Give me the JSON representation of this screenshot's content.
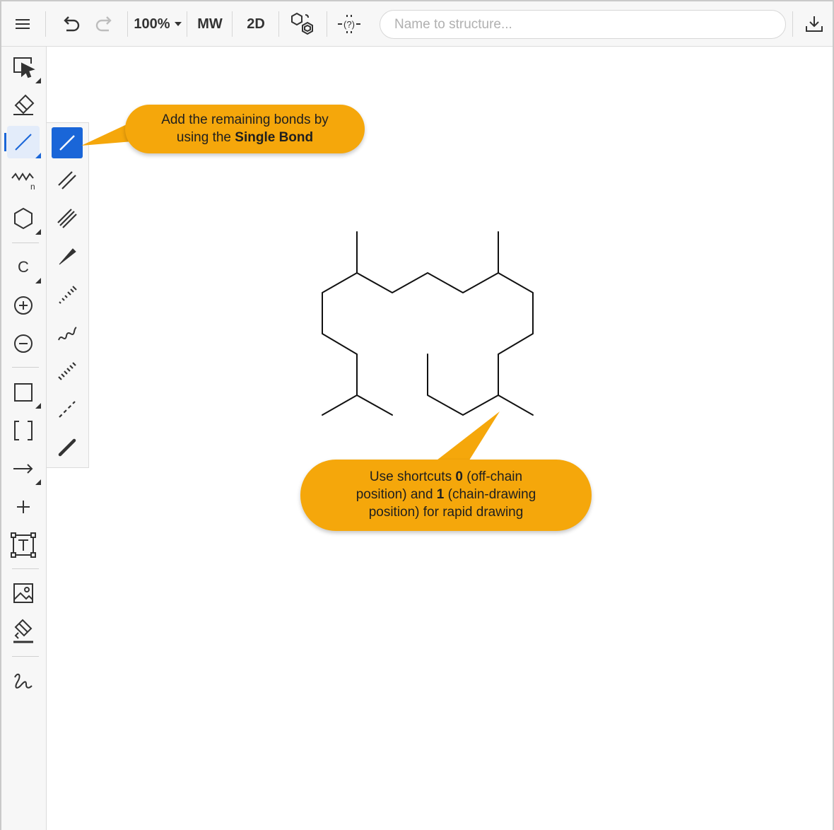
{
  "toolbar": {
    "menu_icon": "hamburger-menu-icon",
    "undo_icon": "undo-icon",
    "redo_icon": "redo-icon",
    "zoom_value": "100%",
    "mw_label": "MW",
    "view_2d_label": "2D",
    "search_placeholder": "Name to structure...",
    "download_icon": "download-icon"
  },
  "left_tools": [
    {
      "name": "select-tool",
      "icon": "select-arrow-icon"
    },
    {
      "name": "erase-tool",
      "icon": "eraser-icon"
    },
    {
      "name": "bond-tool",
      "icon": "single-bond-icon",
      "active": true
    },
    {
      "name": "chain-tool",
      "icon": "chain-icon"
    },
    {
      "name": "ring-tool",
      "icon": "hexagon-icon"
    },
    {
      "name": "atom-tool",
      "label": "C"
    },
    {
      "name": "positive-charge-tool",
      "icon": "plus-circle-icon"
    },
    {
      "name": "negative-charge-tool",
      "icon": "minus-circle-icon"
    },
    {
      "name": "shape-tool",
      "icon": "rectangle-icon"
    },
    {
      "name": "bracket-tool",
      "label": "[ ]"
    },
    {
      "name": "arrow-tool",
      "icon": "arrow-right-icon"
    },
    {
      "name": "plus-tool",
      "icon": "plus-icon"
    },
    {
      "name": "text-tool",
      "icon": "text-box-icon"
    },
    {
      "name": "image-tool",
      "icon": "image-icon"
    },
    {
      "name": "highlight-tool",
      "icon": "highlighter-icon"
    },
    {
      "name": "freehand-tool",
      "icon": "freehand-icon"
    }
  ],
  "bond_types": [
    {
      "name": "single-bond",
      "icon": "single-bond-icon",
      "selected": true
    },
    {
      "name": "double-bond",
      "icon": "double-bond-icon"
    },
    {
      "name": "triple-bond",
      "icon": "triple-bond-icon"
    },
    {
      "name": "wedge-bond",
      "icon": "wedge-bond-icon"
    },
    {
      "name": "hashed-wedge-bond",
      "icon": "hashed-wedge-icon"
    },
    {
      "name": "wavy-bond",
      "icon": "wavy-bond-icon"
    },
    {
      "name": "hashed-bond",
      "icon": "hashed-bond-icon"
    },
    {
      "name": "dashed-bond",
      "icon": "dashed-bond-icon"
    },
    {
      "name": "bold-bond",
      "icon": "bold-bond-icon"
    }
  ],
  "callouts": {
    "bond_hint": {
      "line1": "Add the remaining bonds by",
      "line2_prefix": "using the ",
      "line2_bold": "Single Bond"
    },
    "shortcut_hint": {
      "part1": "Use shortcuts ",
      "key0": "0",
      "part2": " (off-chain",
      "part3": "position) and ",
      "key1": "1",
      "part4": " (chain-drawing",
      "part5": "position) for rapid drawing"
    }
  },
  "colors": {
    "accent": "#1a66d8",
    "callout": "#f5a70b",
    "toolbar_bg": "#f7f7f7"
  }
}
